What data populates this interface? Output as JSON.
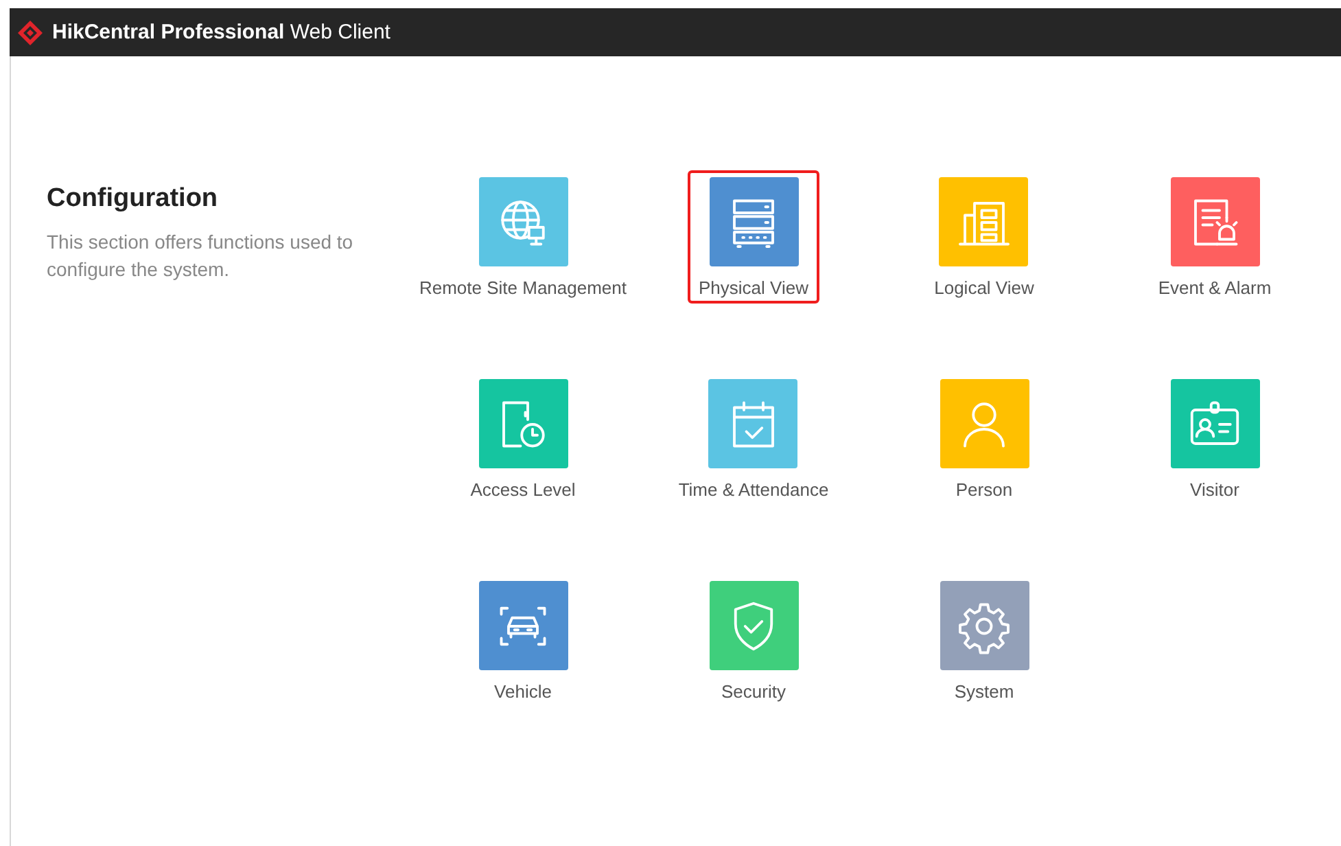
{
  "header": {
    "title": "**HikCentral Professional** Web Client"
  },
  "section": {
    "title": "Configuration",
    "description": "This section offers functions used to configure the system."
  },
  "modules": [
    {
      "label": "Remote Site Management",
      "kind": "globe",
      "color": "#5bc4e3",
      "selected": false
    },
    {
      "label": "Physical View",
      "kind": "server",
      "color": "#4f8fd0",
      "selected": true
    },
    {
      "label": "Logical View",
      "kind": "building",
      "color": "#ffc000",
      "selected": false
    },
    {
      "label": "Event & Alarm",
      "kind": "alarm",
      "color": "#fe5f5f",
      "selected": false
    },
    {
      "label": "Access Level",
      "kind": "door",
      "color": "#15c5a0",
      "selected": false
    },
    {
      "label": "Time & Attendance",
      "kind": "calendar",
      "color": "#5bc4e3",
      "selected": false
    },
    {
      "label": "Person",
      "kind": "person",
      "color": "#ffc000",
      "selected": false
    },
    {
      "label": "Visitor",
      "kind": "badge",
      "color": "#15c5a0",
      "selected": false
    },
    {
      "label": "Vehicle",
      "kind": "car",
      "color": "#4f8fd0",
      "selected": false
    },
    {
      "label": "Security",
      "kind": "shield",
      "color": "#3fcf7c",
      "selected": false
    },
    {
      "label": "System",
      "kind": "gear",
      "color": "#93a0b8",
      "selected": false
    }
  ]
}
